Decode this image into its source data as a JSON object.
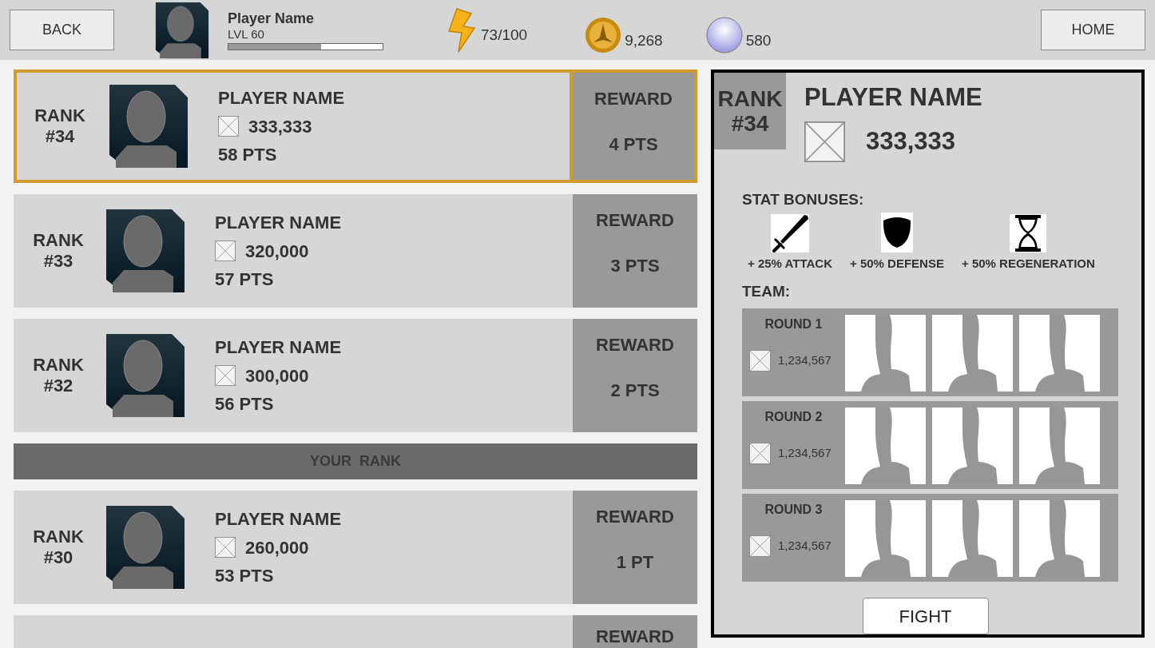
{
  "header": {
    "back": "BACK",
    "player": {
      "name": "Player Name",
      "level_label": "LVL 60",
      "level": 0.6
    },
    "energy": "73/100",
    "coins": "9,268",
    "gems": "580",
    "home": "HOME"
  },
  "leaderboard": [
    {
      "kind": "player",
      "selected": true,
      "rank_label": "RANK",
      "rank": "#34",
      "name": "PLAYER NAME",
      "score": "333,333",
      "points": "58 PTS",
      "reward_label": "REWARD",
      "reward": "4 PTS"
    },
    {
      "kind": "player",
      "selected": false,
      "rank_label": "RANK",
      "rank": "#33",
      "name": "PLAYER NAME",
      "score": "320,000",
      "points": "57 PTS",
      "reward_label": "REWARD",
      "reward": "3 PTS"
    },
    {
      "kind": "player",
      "selected": false,
      "rank_label": "RANK",
      "rank": "#32",
      "name": "PLAYER NAME",
      "score": "300,000",
      "points": "56 PTS",
      "reward_label": "REWARD",
      "reward": "2 PTS"
    },
    {
      "kind": "divider",
      "label": "YOUR  RANK"
    },
    {
      "kind": "player",
      "selected": false,
      "rank_label": "RANK",
      "rank": "#30",
      "name": "PLAYER NAME",
      "score": "260,000",
      "points": "53 PTS",
      "reward_label": "REWARD",
      "reward": "1 PT"
    },
    {
      "kind": "partial",
      "reward_label": "REWARD"
    }
  ],
  "detail": {
    "rank_label": "RANK",
    "rank": "#34",
    "name": "PLAYER NAME",
    "score": "333,333",
    "stat_bonuses_label": "STAT BONUSES:",
    "bonuses": [
      {
        "kind": "attack",
        "label": "+ 25% ATTACK"
      },
      {
        "kind": "defense",
        "label": "+ 50% DEFENSE"
      },
      {
        "kind": "regeneration",
        "label": "+ 50% REGENERATION"
      }
    ],
    "team_label": "TEAM:",
    "rounds": [
      {
        "label": "ROUND 1",
        "score": "1,234,567"
      },
      {
        "label": "ROUND 2",
        "score": "1,234,567"
      },
      {
        "label": "ROUND 3",
        "score": "1,234,567"
      }
    ],
    "fight": "FIGHT"
  }
}
